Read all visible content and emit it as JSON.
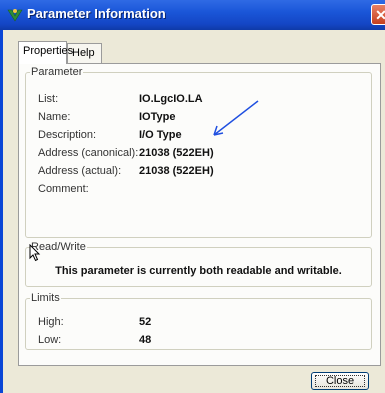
{
  "window": {
    "title": "Parameter Information",
    "close_glyph": "✕",
    "icon": "parameter-info-icon"
  },
  "tabs": [
    {
      "label": "Properties",
      "active": true
    },
    {
      "label": "Help",
      "active": false
    }
  ],
  "parameter": {
    "group_label": "Parameter",
    "rows": [
      {
        "label": "List:",
        "value": "IO.LgcIO.LA"
      },
      {
        "label": "Name:",
        "value": "IOType"
      },
      {
        "label": "Description:",
        "value": "I/O Type"
      },
      {
        "label": "Address (canonical):",
        "value": "21038 (522EH)"
      },
      {
        "label": "Address (actual):",
        "value": "21038 (522EH)"
      },
      {
        "label": "Comment:",
        "value": ""
      }
    ]
  },
  "read_write": {
    "group_label": "Read/Write",
    "message": "This parameter is currently both readable and writable."
  },
  "limits": {
    "group_label": "Limits",
    "rows": [
      {
        "label": "High:",
        "value": "52"
      },
      {
        "label": "Low:",
        "value": "48"
      }
    ]
  },
  "buttons": {
    "close_label": "Close"
  },
  "annotation": {
    "arrow_color": "#1f4fe0"
  }
}
